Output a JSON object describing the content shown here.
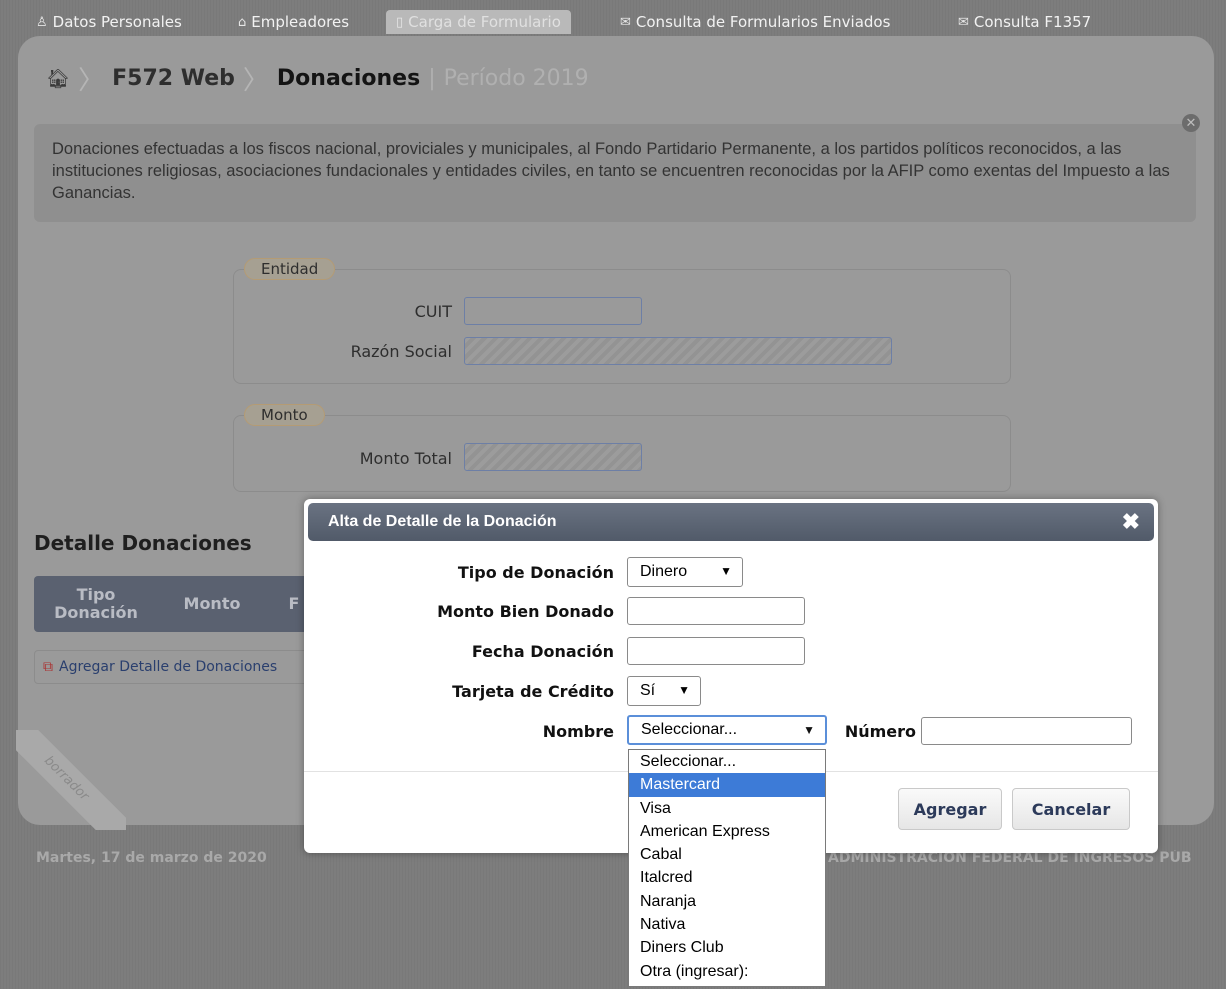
{
  "nav": {
    "tabs": [
      {
        "label": "Datos Personales",
        "icon": "user-icon"
      },
      {
        "label": "Empleadores",
        "icon": "building-icon"
      },
      {
        "label": "Carga de Formulario",
        "icon": "document-icon",
        "active": true
      },
      {
        "label": "Consulta de Formularios Enviados",
        "icon": "envelope-icon"
      },
      {
        "label": "Consulta F1357",
        "icon": "envelope-icon"
      }
    ]
  },
  "breadcrumb": {
    "app": "F572 Web",
    "current": "Donaciones",
    "separator": "|",
    "period": "Período 2019"
  },
  "info": {
    "text": "Donaciones efectuadas a los fiscos nacional, proviciales y municipales, al Fondo Partidario Permanente, a los partidos políticos reconocidos, a las instituciones religiosas, asociaciones fundacionales y entidades civiles, en tanto se encuentren reconocidas por la AFIP como exentas del Impuesto a las Ganancias."
  },
  "entidad": {
    "legend": "Entidad",
    "cuit_label": "CUIT",
    "razon_label": "Razón Social"
  },
  "monto": {
    "legend": "Monto",
    "total_label": "Monto Total"
  },
  "detalle": {
    "title": "Detalle Donaciones",
    "col_tipo_1": "Tipo",
    "col_tipo_2": "Donación",
    "col_monto": "Monto",
    "col_fecha": "F",
    "add_link": "Agregar Detalle de Donaciones"
  },
  "watermark": "borrador",
  "footer": {
    "date": "Martes, 17 de marzo de 2020",
    "org": "ADMINISTRACIÓN FEDERAL DE INGRESOS PÚBLICOS"
  },
  "modal": {
    "title": "Alta de Detalle de la Donación",
    "close_glyph": "✖",
    "tipo_label": "Tipo de Donación",
    "tipo_value": "Dinero",
    "monto_label": "Monto Bien Donado",
    "fecha_label": "Fecha Donación",
    "tarjeta_label": "Tarjeta de Crédito",
    "tarjeta_value": "Sí",
    "nombre_label": "Nombre",
    "nombre_value": "Seleccionar...",
    "numero_label": "Número",
    "agregar_btn": "Agregar",
    "cancelar_btn": "Cancelar"
  },
  "dropdown": {
    "options": [
      "Seleccionar...",
      "Mastercard",
      "Visa",
      "American Express",
      "Cabal",
      "Italcred",
      "Naranja",
      "Nativa",
      "Diners Club",
      "Otra (ingresar):"
    ],
    "highlighted_index": 1,
    "highlight_color": "#3d7bd7"
  }
}
